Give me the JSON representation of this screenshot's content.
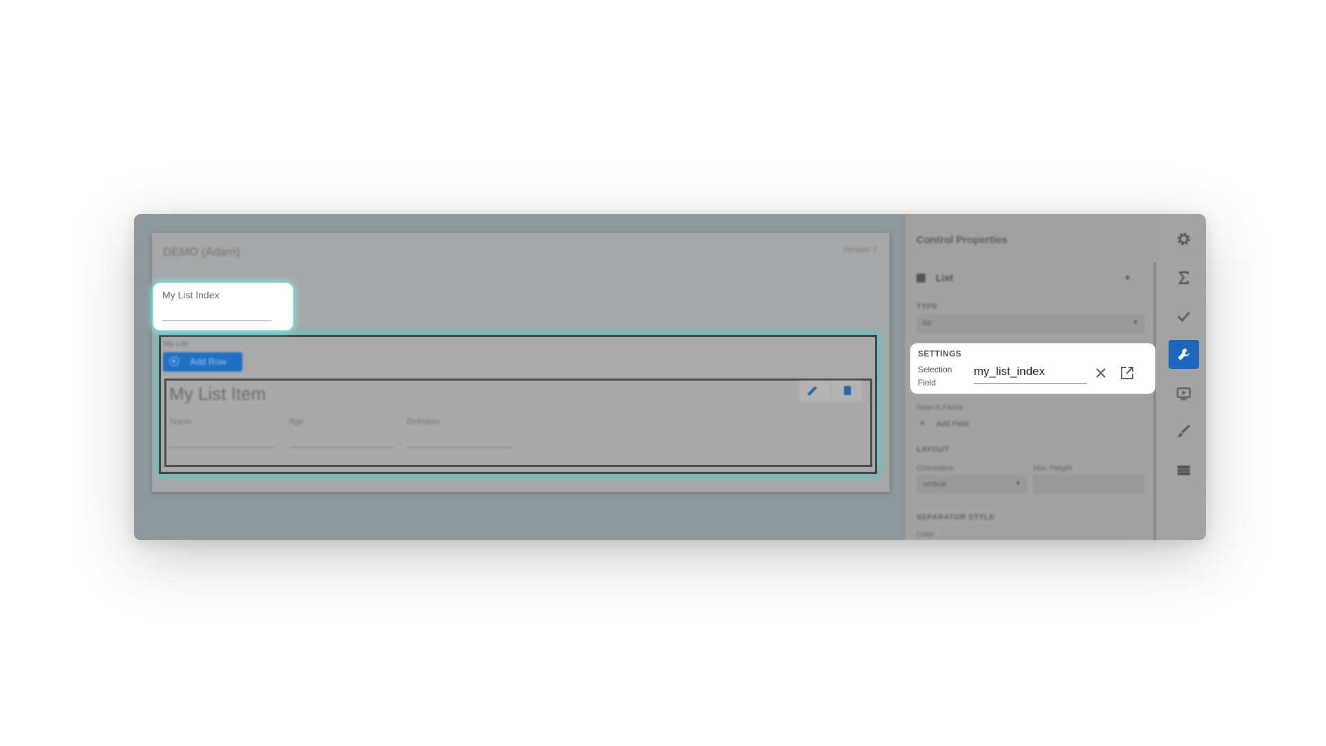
{
  "canvas": {
    "form_title": "DEMO (Adam)",
    "version": "version 7",
    "index_field": {
      "label": "My List Index",
      "value": ""
    },
    "list": {
      "label": "My List",
      "add_row_label": "Add Row",
      "item": {
        "title": "My List Item",
        "fields": [
          "Name",
          "Age",
          "Birthdate"
        ]
      }
    }
  },
  "panel": {
    "title": "Control Properties",
    "section": {
      "name": "List"
    },
    "type": {
      "caption": "TYPE",
      "value": "list"
    },
    "settings": {
      "caption": "SETTINGS",
      "selection_field_label": "Selection Field",
      "selection_field_value": "my_list_index"
    },
    "search_fields": {
      "label": "Search Fields",
      "add_label": "Add Field"
    },
    "layout": {
      "caption": "LAYOUT",
      "orientation_label": "Orientation",
      "orientation_value": "vertical",
      "max_height_label": "Max Height",
      "max_height_value": ""
    },
    "separator": {
      "caption": "SEPARATOR STYLE",
      "color_label": "Color"
    }
  },
  "rail": {
    "icons": [
      "gear-icon",
      "sigma-icon",
      "check-icon",
      "wrench-icon",
      "preview-icon",
      "brush-icon",
      "table-icon"
    ],
    "active": "wrench-icon"
  },
  "colors": {
    "accent": "#1c66bf",
    "highlight_glow": "#82e8e4",
    "overlay": "#8f989d"
  }
}
